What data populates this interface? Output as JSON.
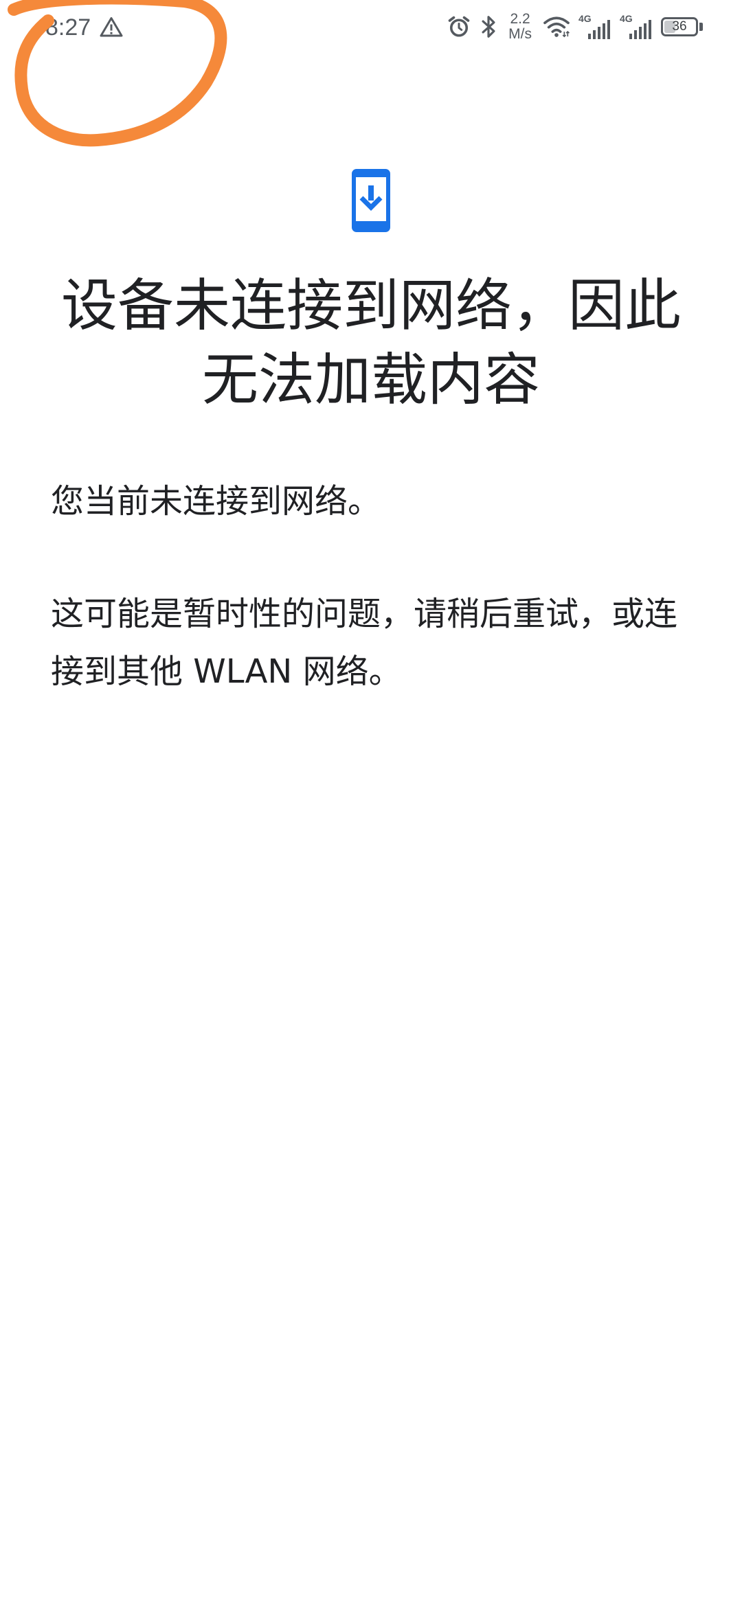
{
  "status_bar": {
    "time": "8:27",
    "net_speed_value": "2.2",
    "net_speed_unit": "M/s",
    "signal_1_label": "4G",
    "signal_2_label": "4G",
    "battery_level": "36",
    "battery_fraction": 0.36,
    "icons": [
      "warning-icon",
      "alarm-icon",
      "bluetooth-icon",
      "wifi-icon",
      "signal-icon",
      "battery-icon"
    ]
  },
  "page": {
    "icon": "phone-download-icon",
    "headline": "设备未连接到网络，因此无法加载内容",
    "message_1": "您当前未连接到网络。",
    "message_2": "这可能是暂时性的问题，请稍后重试，或连接到其他 WLAN 网络。"
  },
  "colors": {
    "accent": "#1a73e8",
    "annotation": "#f5893a",
    "text": "#202124",
    "status_icons": "#555a60",
    "background": "#ffffff"
  }
}
